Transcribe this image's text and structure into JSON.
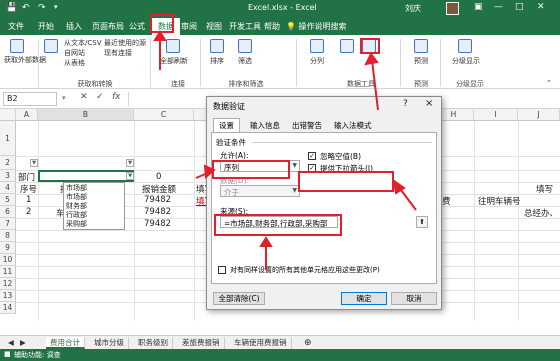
{
  "titlebar": {
    "file_title": "Excel.xlsx - Excel",
    "user": "刘庆",
    "save_icon": "save-icon",
    "undo_icon": "undo-icon",
    "redo_icon": "redo-icon"
  },
  "tabs": [
    {
      "label": "文件"
    },
    {
      "label": "开始"
    },
    {
      "label": "插入"
    },
    {
      "label": "页面布局"
    },
    {
      "label": "公式"
    },
    {
      "label": "数据",
      "active": true
    },
    {
      "label": "审阅"
    },
    {
      "label": "视图"
    },
    {
      "label": "开发工具"
    },
    {
      "label": "帮助"
    }
  ],
  "tellme": "操作说明搜索",
  "ribbon": {
    "get_data_label": "获取外部数据",
    "new_query_items": [
      "从文本/CSV",
      "自网站",
      "从表格",
      "最近使用的源",
      "现有连接"
    ],
    "refresh_label": "全部刷新",
    "buttons": [
      "排序",
      "筛选",
      "分列",
      "预测",
      "分级显示"
    ],
    "groups": [
      "获取和转换",
      "连接",
      "排序和筛选",
      "数据工具",
      "预测",
      "分级显示"
    ]
  },
  "formula_bar": {
    "name_box": "B2",
    "fx": "fx"
  },
  "columns": [
    "A",
    "B",
    "C",
    "D",
    "E",
    "F",
    "G",
    "H",
    "I",
    "J"
  ],
  "rows": [
    "1",
    "2",
    "3",
    "4",
    "5",
    "6",
    "7",
    "8",
    "9",
    "10",
    "11",
    "12",
    "13",
    "14"
  ],
  "cells": {
    "r3_a": "部门",
    "r4": [
      "序号",
      "报销",
      "报销金额",
      "填写"
    ],
    "r4_right": "填写",
    "r5": [
      "1",
      "差",
      "79482",
      "填写"
    ],
    "r6": [
      "2",
      "车辆使",
      "79482"
    ],
    "r7": [
      "合计",
      "79482"
    ],
    "r5_right": [
      "费",
      "往明车辆号"
    ],
    "r6_right": [
      "总经办、"
    ],
    "r5_zero": "0"
  },
  "dropdown_list": [
    "市场部",
    "市场部",
    "财务部",
    "行政部",
    "采购部"
  ],
  "sheet_tabs": [
    "费用合计",
    "城市分级",
    "职务级别",
    "差旅费报销",
    "车辆使用费报销"
  ],
  "active_sheet": "费用合计",
  "status": "辅助功能: 调查",
  "dialog": {
    "title": "数据验证",
    "help": "?",
    "close": "×",
    "tabs": [
      "设置",
      "输入信息",
      "出错警告",
      "输入法模式"
    ],
    "section_label": "验证条件",
    "allow_label": "允许(A):",
    "allow_value": "序列",
    "data_label": "数据(D):",
    "data_value": "介于",
    "ignore_blank": "忽略空值(B)",
    "in_cell_dropdown": "提供下拉箭头(I)",
    "source_label": "来源(S):",
    "source_value": "=市场部,财务部,行政部,采购部",
    "apply_all": "对有同样设置的所有其他单元格应用这些更改(P)",
    "clear_all": "全部清除(C)",
    "ok": "确定",
    "cancel": "取消"
  },
  "colors": {
    "excel_green": "#217346",
    "annotation_red": "#e0202a",
    "dialog_bg": "#f0f0f0"
  }
}
